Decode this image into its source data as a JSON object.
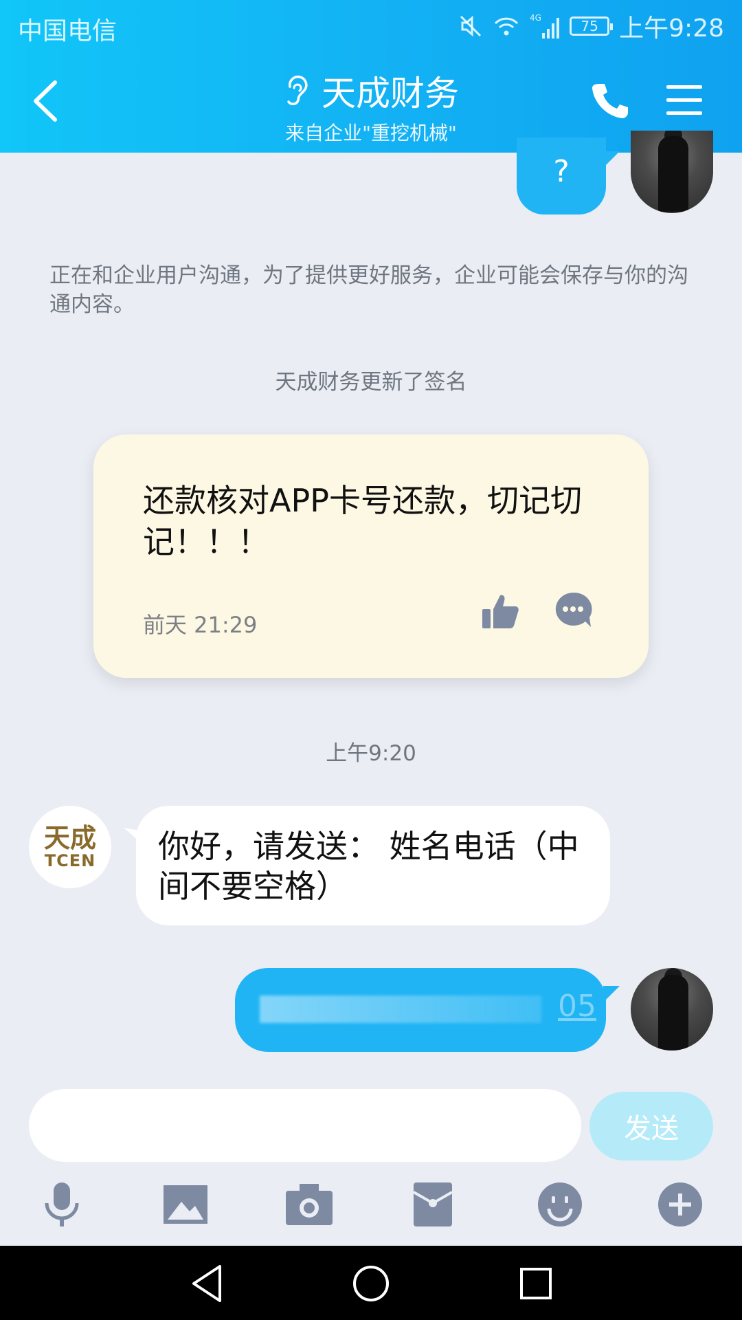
{
  "status_bar": {
    "carrier": "中国电信",
    "battery": "75",
    "network": "4G",
    "time": "上午9:28"
  },
  "header": {
    "title": "天成财务",
    "subtitle": "来自企业\"重挖机械\"",
    "color": "#13b2f4"
  },
  "messages": {
    "question_mark": "?",
    "notice": "正在和企业用户沟通，为了提供更好服务，企业可能会保存与你的沟通内容。",
    "signature_update": "天成财务更新了签名",
    "signature_card": {
      "text": "还款核对APP卡号还款，切记切记！！！",
      "time": "前天 21:29"
    },
    "timestamp": "上午9:20",
    "incoming_text": "你好，请发送： 姓名电话（中间不要空格）",
    "outgoing_visible_suffix": "05"
  },
  "company_avatar": {
    "cn": "天成",
    "en": "TCEN"
  },
  "input": {
    "value": "",
    "send_label": "发送"
  },
  "icons": {
    "toolbar": [
      "microphone-icon",
      "image-icon",
      "camera-icon",
      "red-packet-icon",
      "emoji-icon",
      "plus-icon"
    ],
    "nav": [
      "back-triangle-icon",
      "home-circle-icon",
      "recent-square-icon"
    ]
  }
}
